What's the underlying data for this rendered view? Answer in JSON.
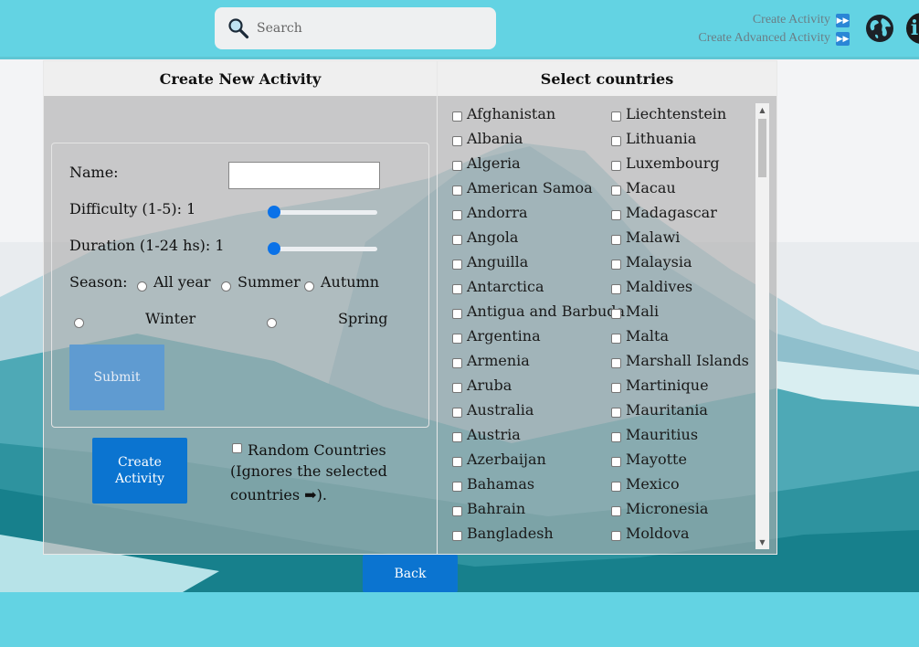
{
  "search": {
    "placeholder": "Search"
  },
  "nav": {
    "create_activity": "Create Activity",
    "create_advanced_activity": "Create Advanced Activity"
  },
  "icons": {
    "search": "magnifier-icon",
    "globe": "globe-icon",
    "info": "info-icon",
    "forward": "fast-forward-icon"
  },
  "left_panel": {
    "title": "Create New Activity",
    "name_label": "Name:",
    "name_value": "",
    "difficulty_label": "Difficulty (1-5): 1",
    "difficulty_value": 1,
    "duration_label": "Duration (1-24 hs): 1",
    "duration_value": 1,
    "season_label": "Season:",
    "seasons": [
      "All year",
      "Summer",
      "Autumn",
      "Winter",
      "Spring"
    ],
    "submit_label": "Submit",
    "create_label": "Create Activity",
    "random_label": "Random Countries",
    "random_note": "(Ignores the selected countries ➡)."
  },
  "right_panel": {
    "title": "Select countries",
    "col1": [
      "Afghanistan",
      "Albania",
      "Algeria",
      "American Samoa",
      "Andorra",
      "Angola",
      "Anguilla",
      "Antarctica",
      "Antigua and Barbuda",
      "Argentina",
      "Armenia",
      "Aruba",
      "Australia",
      "Austria",
      "Azerbaijan",
      "Bahamas",
      "Bahrain",
      "Bangladesh"
    ],
    "col2": [
      "Liechtenstein",
      "Lithuania",
      "Luxembourg",
      "Macau",
      "Madagascar",
      "Malawi",
      "Malaysia",
      "Maldives",
      "Mali",
      "Malta",
      "Marshall Islands",
      "Martinique",
      "Mauritania",
      "Mauritius",
      "Mayotte",
      "Mexico",
      "Micronesia",
      "Moldova"
    ]
  },
  "back_label": "Back",
  "colors": {
    "sky": "#63d3e3",
    "button": "#0b74d0",
    "submit_disabled": "#5f9bd1",
    "slider": "#0b72e8"
  }
}
